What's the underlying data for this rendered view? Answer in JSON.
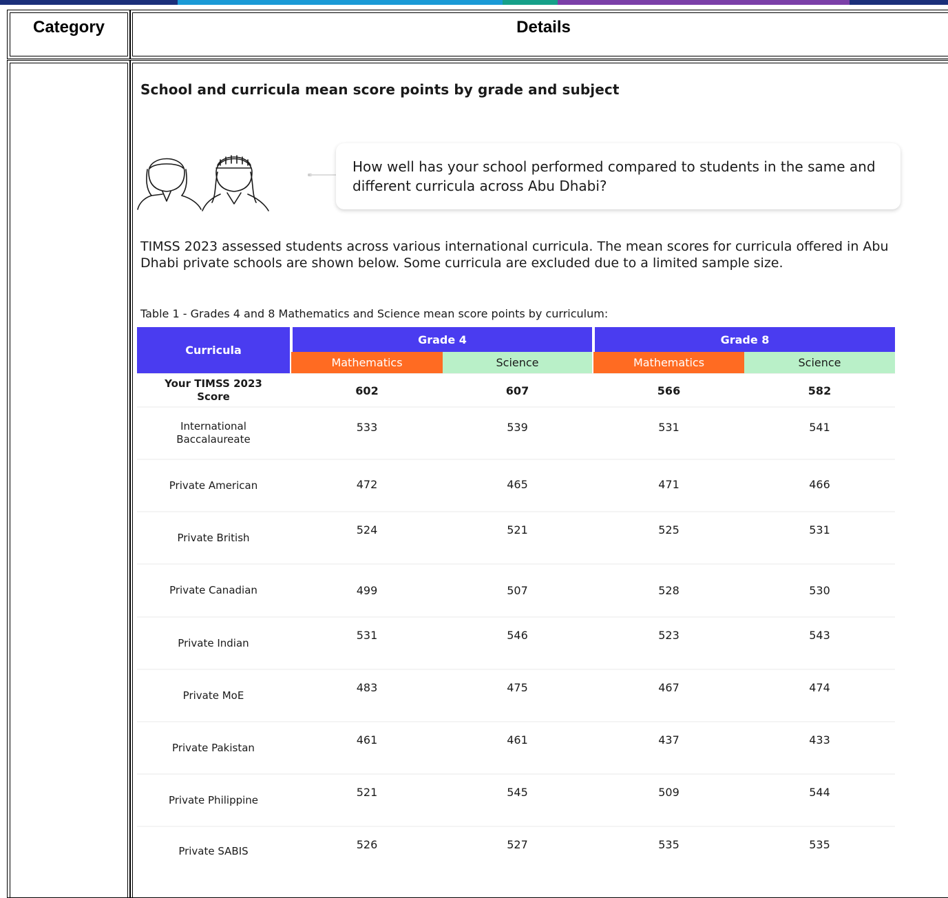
{
  "header": {
    "category_label": "Category",
    "details_label": "Details"
  },
  "section": {
    "heading": "School and curricula mean score points by grade and subject",
    "question": "How well has your school performed compared to students in the same and different curricula across Abu Dhabi?",
    "paragraph": "TIMSS 2023 assessed students across various international curricula. The mean scores for curricula offered in Abu Dhabi private schools are shown below. Some curricula are excluded due to a limited sample size.",
    "caption": "Table 1 - Grades 4 and 8 Mathematics and Science mean score points by curriculum:"
  },
  "table": {
    "corner": "Curricula",
    "grades": [
      "Grade 4",
      "Grade 8"
    ],
    "subjects": [
      "Mathematics",
      "Science",
      "Mathematics",
      "Science"
    ],
    "rows": [
      {
        "label": "Your TIMSS 2023 Score",
        "values": [
          "602",
          "607",
          "566",
          "582"
        ]
      },
      {
        "label": "International Baccalaureate",
        "values": [
          "533",
          "539",
          "531",
          "541"
        ]
      },
      {
        "label": "Private American",
        "values": [
          "472",
          "465",
          "471",
          "466"
        ]
      },
      {
        "label": "Private British",
        "values": [
          "524",
          "521",
          "525",
          "531"
        ]
      },
      {
        "label": "Private Canadian",
        "values": [
          "499",
          "507",
          "528",
          "530"
        ]
      },
      {
        "label": "Private Indian",
        "values": [
          "531",
          "546",
          "523",
          "543"
        ]
      },
      {
        "label": "Private MoE",
        "values": [
          "483",
          "475",
          "467",
          "474"
        ]
      },
      {
        "label": "Private Pakistan",
        "values": [
          "461",
          "461",
          "437",
          "433"
        ]
      },
      {
        "label": "Private Philippine",
        "values": [
          "521",
          "545",
          "509",
          "544"
        ]
      },
      {
        "label": "Private SABIS",
        "values": [
          "526",
          "527",
          "535",
          "535"
        ]
      }
    ]
  },
  "colors": {
    "header_purple": "#4a3cf0",
    "math_orange": "#ff6b22",
    "science_green": "#b9f0c8",
    "topbar": [
      "#1b2f7a",
      "#1a9ad6",
      "#16a089",
      "#7b3fa8",
      "#1b2f7a"
    ]
  }
}
